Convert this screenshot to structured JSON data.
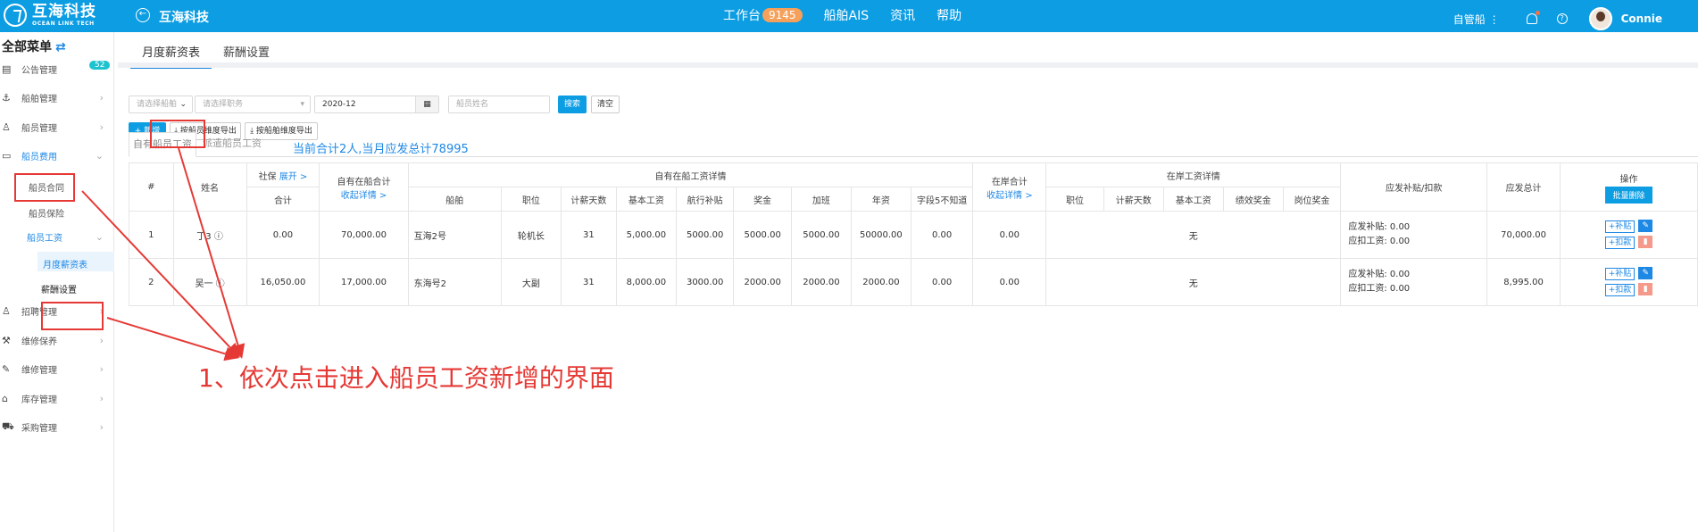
{
  "topbar": {
    "logo_cn": "互海科技",
    "logo_en": "OCEAN LINK TECH",
    "app_title": "互海科技",
    "nav": [
      {
        "label": "工作台",
        "badge": "9145"
      },
      {
        "label": "船舶AIS"
      },
      {
        "label": "资讯"
      },
      {
        "label": "帮助"
      }
    ],
    "ship_selector": "自管船",
    "username": "Connie",
    "bg_color": "#0c9de3"
  },
  "sidebar": {
    "title": "全部菜单",
    "items": [
      {
        "label": "公告管理",
        "badge": "52",
        "icon": "newspaper-icon"
      },
      {
        "label": "船舶管理",
        "icon": "anchor-icon"
      },
      {
        "label": "船员管理",
        "icon": "person-icon"
      },
      {
        "label": "船员费用",
        "icon": "wallet-icon"
      },
      {
        "label": "船员合同"
      },
      {
        "label": "船员保险"
      },
      {
        "label": "船员工资"
      },
      {
        "label": "月度薪资表"
      },
      {
        "label": "薪酬设置"
      },
      {
        "label": "招聘管理",
        "icon": "person-icon"
      },
      {
        "label": "维修保养",
        "icon": "hammer-icon"
      },
      {
        "label": "维修管理",
        "icon": "wrench-icon"
      },
      {
        "label": "库存管理",
        "icon": "warehouse-icon"
      },
      {
        "label": "采购管理",
        "icon": "cart-icon"
      }
    ]
  },
  "page_tabs": [
    "月度薪资表",
    "薪酬设置"
  ],
  "filters": {
    "ship_placeholder": "请选择船舶",
    "position_placeholder": "请选择职务",
    "month_value": "2020-12",
    "name_placeholder": "船员姓名",
    "search_label": "搜索",
    "clear_label": "清空"
  },
  "actions": {
    "add_label": "+ 新增",
    "export_person_label": "按船员维度导出",
    "export_ship_label": "按船舶维度导出"
  },
  "sub_tabs": [
    "自有船员工资",
    "派遣船员工资"
  ],
  "summary": "当前合计2人,当月应发总计78995",
  "table": {
    "headers": {
      "index": "#",
      "name": "姓名",
      "social_security": "社保",
      "expand": "展开 >",
      "total": "合计",
      "onboard_total": "自有在船合计",
      "collapse_detail": "收起详情 >",
      "onboard_detail": "自有在船工资详情",
      "ship": "船舶",
      "position": "职位",
      "pay_days": "计薪天数",
      "base_salary": "基本工资",
      "voyage_allowance": "航行补贴",
      "bonus": "奖金",
      "overtime": "加班",
      "seniority": "年资",
      "field5": "字段5不知道",
      "ashore_total": "在岸合计",
      "ashore_collapse": "收起详情 >",
      "ashore_detail": "在岸工资详情",
      "ashore_position": "职位",
      "ashore_days": "计薪天数",
      "ashore_base": "基本工资",
      "performance_bonus": "绩效奖金",
      "post_bonus": "岗位奖金",
      "adjust": "应发补贴/扣款",
      "grand_total": "应发总计",
      "ops": "操作",
      "bulk_delete": "批量删除"
    },
    "rows": [
      {
        "index": "1",
        "name": "丁3",
        "social": "0.00",
        "onboard_total": "70,000.00",
        "ship": "互海2号",
        "position": "轮机长",
        "days": "31",
        "base": "5,000.00",
        "voyage": "5000.00",
        "bonus": "5000.00",
        "overtime": "5000.00",
        "seniority": "50000.00",
        "field5": "0.00",
        "ashore_total": "0.00",
        "ashore": "无",
        "allowance": "应发补贴: 0.00",
        "deduction": "应扣工资: 0.00",
        "grand_total": "70,000.00"
      },
      {
        "index": "2",
        "name": "吴一",
        "social": "16,050.00",
        "onboard_total": "17,000.00",
        "ship": "东海号2",
        "position": "大副",
        "days": "31",
        "base": "8,000.00",
        "voyage": "3000.00",
        "bonus": "2000.00",
        "overtime": "2000.00",
        "seniority": "2000.00",
        "field5": "0.00",
        "ashore_total": "0.00",
        "ashore": "无",
        "allowance": "应发补贴: 0.00",
        "deduction": "应扣工资: 0.00",
        "grand_total": "8,995.00"
      }
    ],
    "op_add": "+补贴",
    "op_deduct": "+扣款"
  },
  "annotation": {
    "text": "1、依次点击进入船员工资新增的界面",
    "color": "#e53935"
  }
}
